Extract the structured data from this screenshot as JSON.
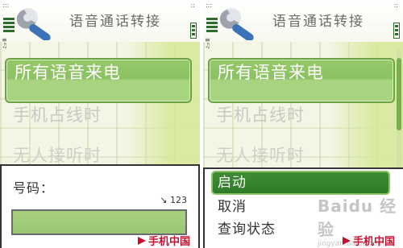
{
  "screens": [
    {
      "title": "语音通话转接",
      "list": [
        "所有语音来电",
        "手机占线时",
        "无人接听时"
      ],
      "dialog": {
        "label": "号码：",
        "counter": "123",
        "input_value": "",
        "brand": "手机中国"
      }
    },
    {
      "title": "语音通话转接",
      "list": [
        "所有语音来电",
        "手机占线时",
        "无人接听时"
      ],
      "menu": [
        "启动",
        "取消",
        "查询状态"
      ],
      "brand": "手机中国",
      "watermark": "Baidu 经验",
      "watermark_sub": "jingyan.baidu.com"
    }
  ],
  "colors": {
    "accent_green": "#8cc263",
    "menu_selected": "#2f7a28",
    "brand_red": "#c8102e"
  },
  "icons": [
    "wrench-icon",
    "signal-icon",
    "battery-icon"
  ]
}
